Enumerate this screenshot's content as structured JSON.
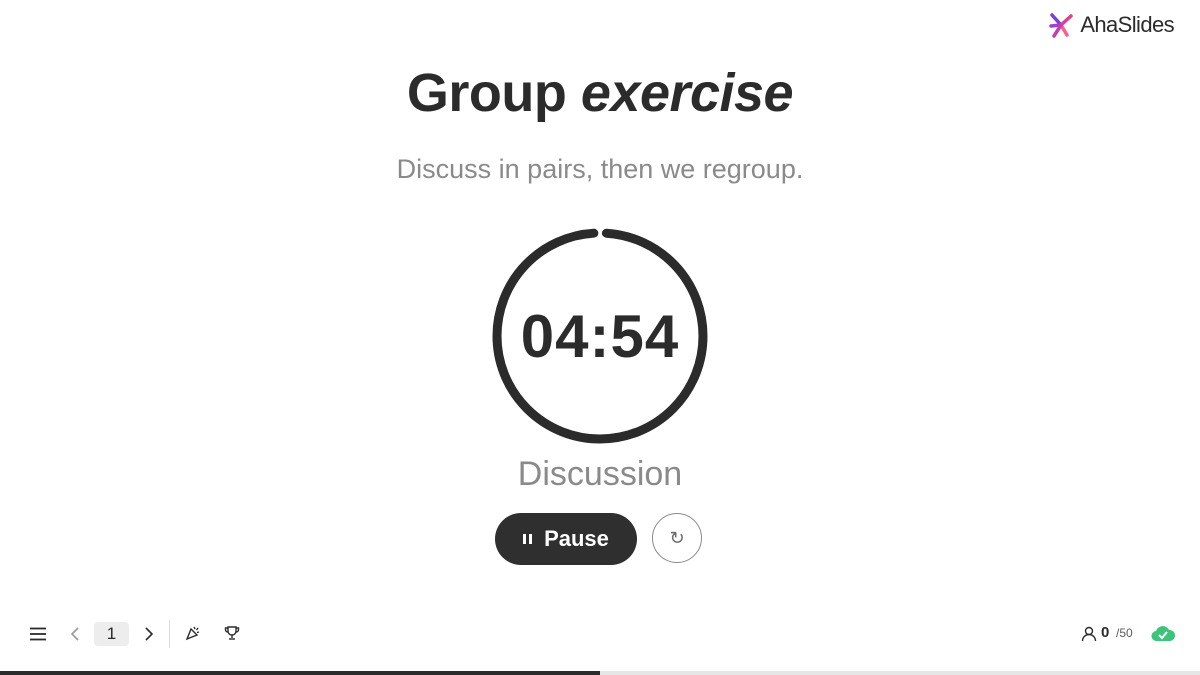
{
  "brand": {
    "name": "AhaSlides"
  },
  "slide": {
    "title_plain": "Group ",
    "title_italic": "exercise",
    "subtitle": "Discuss in pairs, then we regroup."
  },
  "timer": {
    "display": "04:54",
    "label": "Discussion",
    "remaining_fraction": 0.98
  },
  "controls": {
    "pause_label": "Pause",
    "reset_symbol": "↻"
  },
  "navigation": {
    "page": "1"
  },
  "audience": {
    "count": "0",
    "max": "/50"
  },
  "icons": [
    "ahaslides-logo-icon",
    "pause-icon",
    "reset-icon",
    "menu-icon",
    "chevron-left-icon",
    "chevron-right-icon",
    "party-popper-icon",
    "trophy-icon",
    "user-icon",
    "check-cloud-icon"
  ],
  "colors": {
    "text_dark": "#2b2b2b",
    "text_muted": "#8a8a8a",
    "button_dark": "#2f2f2f",
    "status_green": "#3cc57a",
    "logo_pink": "#e33d8f",
    "logo_purple": "#7a3fd9"
  },
  "progress": {
    "fraction": 0.5
  }
}
